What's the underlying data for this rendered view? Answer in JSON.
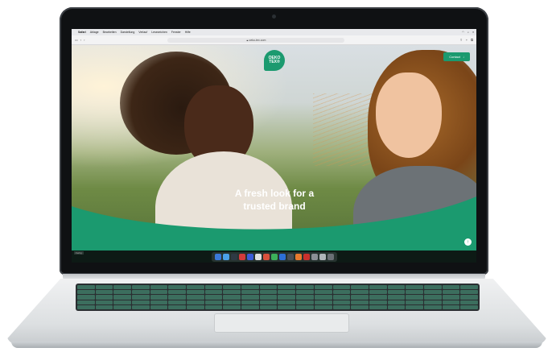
{
  "menubar": {
    "apple": "",
    "items": [
      "Safari",
      "Ablage",
      "Bearbeiten",
      "Darstellung",
      "Verlauf",
      "Lesezeichen",
      "Fenster",
      "Hilfe"
    ]
  },
  "browser": {
    "url": "oeko-tex.com"
  },
  "site": {
    "logo_line1": "OEKO",
    "logo_line2": "TEX®",
    "contact_label": "Contact",
    "contact_arrow": "↓",
    "hero_title": "A fresh look for a trusted brand",
    "corner_glyph": "↑"
  },
  "colors": {
    "brand_green": "#1b9a6f",
    "key_tint": "#3c6e5e"
  },
  "dock": {
    "icons": [
      "#3a78d8",
      "#4aa0e8",
      "#2f3a44",
      "#d23b3b",
      "#3b5bd8",
      "#e0e0e0",
      "#d8503c",
      "#3cb05a",
      "#2d6fd6",
      "#4a4e55",
      "#e87a2e",
      "#c9302c",
      "#8a8f95",
      "#b0b5ba",
      "#6a6f75"
    ]
  },
  "status_tag": "Fertig"
}
